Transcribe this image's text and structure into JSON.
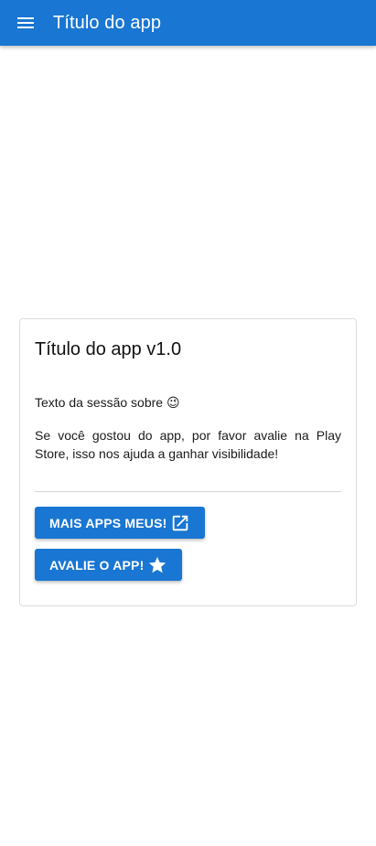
{
  "app_bar": {
    "title": "Título do app",
    "menu_icon": "menu-icon"
  },
  "card": {
    "title": "Título do app v1.0",
    "section_text": "Texto da sessão sobre 😉",
    "rate_message": "Se você gostou do app, por favor avalie na Play Store, isso nos ajuda a ganhar visibilidade!",
    "more_apps_button": {
      "label": "MAIS APPS MEUS!",
      "icon": "open-in-new-icon"
    },
    "rate_button": {
      "label": "AVALIE O APP!",
      "icon": "star-icon"
    }
  },
  "colors": {
    "primary": "#1976d2",
    "background": "#ffffff"
  }
}
